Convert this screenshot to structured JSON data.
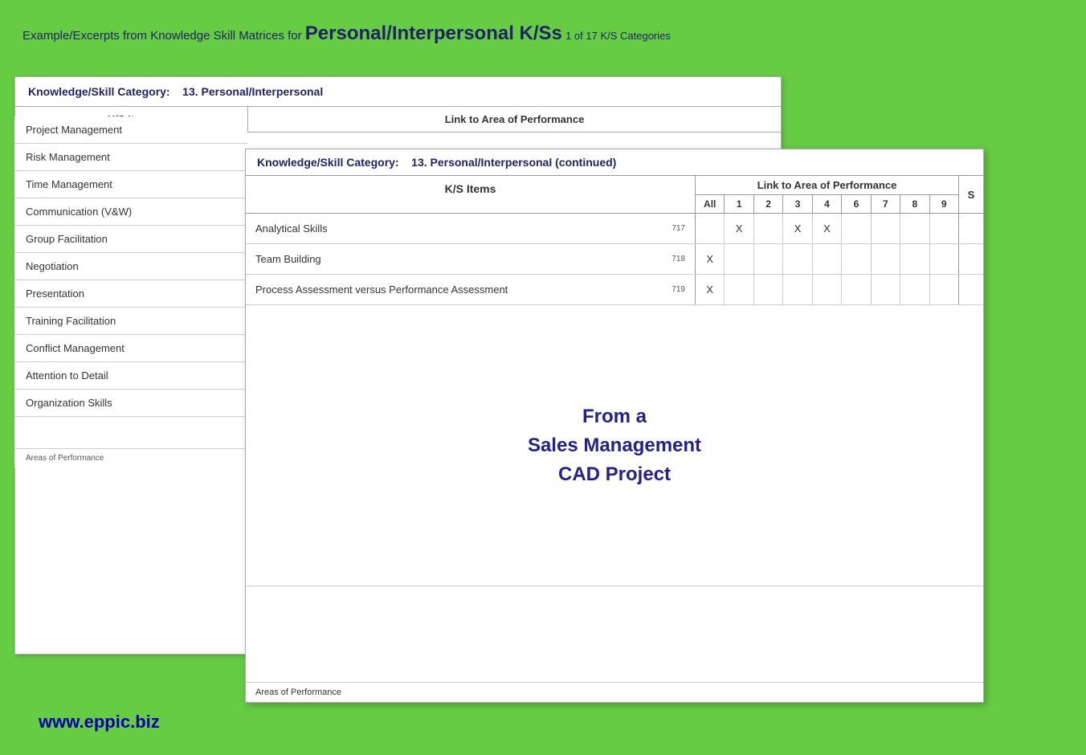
{
  "header": {
    "prefix": "Example/Excerpts from Knowledge Skill Matrices for",
    "bold": "Personal/Interpersonal K/Ss",
    "suffix": "1 of 17 K/S Categories"
  },
  "card_back": {
    "category_label": "Knowledge/Skill Category:",
    "category_value": "13. Personal/Interpersonal",
    "ks_items_header": "K/S Items",
    "link_header": "Link to Area of Performance"
  },
  "card_front": {
    "category_label": "Knowledge/Skill Category:",
    "category_value": "13. Personal/Interpersonal (continued)",
    "ks_items_header": "K/S Items",
    "link_header": "Link to Area of Performance",
    "col_numbers": [
      "All",
      "1",
      "2",
      "3",
      "4",
      "6",
      "7",
      "8",
      "9"
    ],
    "rows": [
      {
        "item": "Analytical Skills",
        "num": "717",
        "cols": [
          "",
          "X",
          "",
          "X",
          "X",
          "",
          "",
          "",
          ""
        ]
      },
      {
        "item": "Team Building",
        "num": "718",
        "cols": [
          "X",
          "",
          "",
          "",
          "",
          "",
          "",
          "",
          ""
        ]
      },
      {
        "item": "Process Assessment versus Performance Assessment",
        "num": "719",
        "cols": [
          "X",
          "",
          "",
          "",
          "",
          "",
          "",
          "",
          ""
        ]
      }
    ],
    "content_text": "From a\nSales Management\nCAD Project",
    "areas_footer": "Areas of Performance"
  },
  "ks_list": {
    "items": [
      "Project Management",
      "Risk Management",
      "Time Management",
      "Communication (V&W)",
      "Group Facilitation",
      "Negotiation",
      "Presentation",
      "Training Facilitation",
      "Conflict Management",
      "Attention to Detail",
      "Organization Skills"
    ],
    "footer": "Areas of Performance"
  },
  "website": "www.eppic.biz"
}
